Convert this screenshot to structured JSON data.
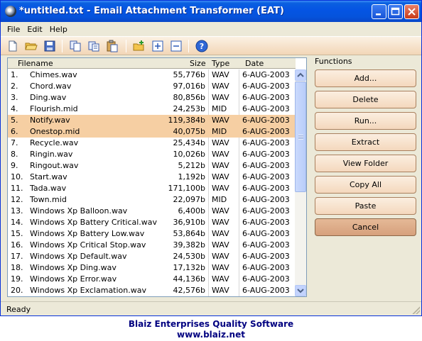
{
  "window": {
    "title": "*untitled.txt - Email Attachment Transformer (EAT)"
  },
  "menu": [
    "File",
    "Edit",
    "Help"
  ],
  "toolbar_icons": [
    "new-file-icon",
    "open-folder-icon",
    "save-icon",
    "copy-icon",
    "cut-icon",
    "paste-icon",
    "add-folder-icon",
    "add-icon",
    "remove-icon",
    "help-icon"
  ],
  "list": {
    "headers": {
      "filename": "Filename",
      "size": "Size",
      "type": "Type",
      "date": "Date"
    },
    "rows": [
      {
        "num": "1.",
        "name": "Chimes.wav",
        "size": "55,776b",
        "type": "WAV",
        "date": "6-AUG-2003",
        "selected": false
      },
      {
        "num": "2.",
        "name": "Chord.wav",
        "size": "97,016b",
        "type": "WAV",
        "date": "6-AUG-2003",
        "selected": false
      },
      {
        "num": "3.",
        "name": "Ding.wav",
        "size": "80,856b",
        "type": "WAV",
        "date": "6-AUG-2003",
        "selected": false
      },
      {
        "num": "4.",
        "name": "Flourish.mid",
        "size": "24,253b",
        "type": "MID",
        "date": "6-AUG-2003",
        "selected": false
      },
      {
        "num": "5.",
        "name": "Notify.wav",
        "size": "119,384b",
        "type": "WAV",
        "date": "6-AUG-2003",
        "selected": true
      },
      {
        "num": "6.",
        "name": "Onestop.mid",
        "size": "40,075b",
        "type": "MID",
        "date": "6-AUG-2003",
        "selected": true
      },
      {
        "num": "7.",
        "name": "Recycle.wav",
        "size": "25,434b",
        "type": "WAV",
        "date": "6-AUG-2003",
        "selected": false
      },
      {
        "num": "8.",
        "name": "Ringin.wav",
        "size": "10,026b",
        "type": "WAV",
        "date": "6-AUG-2003",
        "selected": false
      },
      {
        "num": "9.",
        "name": "Ringout.wav",
        "size": "5,212b",
        "type": "WAV",
        "date": "6-AUG-2003",
        "selected": false
      },
      {
        "num": "10.",
        "name": "Start.wav",
        "size": "1,192b",
        "type": "WAV",
        "date": "6-AUG-2003",
        "selected": false
      },
      {
        "num": "11.",
        "name": "Tada.wav",
        "size": "171,100b",
        "type": "WAV",
        "date": "6-AUG-2003",
        "selected": false
      },
      {
        "num": "12.",
        "name": "Town.mid",
        "size": "22,097b",
        "type": "MID",
        "date": "6-AUG-2003",
        "selected": false
      },
      {
        "num": "13.",
        "name": "Windows Xp Balloon.wav",
        "size": "6,400b",
        "type": "WAV",
        "date": "6-AUG-2003",
        "selected": false
      },
      {
        "num": "14.",
        "name": "Windows Xp Battery Critical.wav",
        "size": "36,910b",
        "type": "WAV",
        "date": "6-AUG-2003",
        "selected": false
      },
      {
        "num": "15.",
        "name": "Windows Xp Battery Low.wav",
        "size": "53,864b",
        "type": "WAV",
        "date": "6-AUG-2003",
        "selected": false
      },
      {
        "num": "16.",
        "name": "Windows Xp Critical Stop.wav",
        "size": "39,382b",
        "type": "WAV",
        "date": "6-AUG-2003",
        "selected": false
      },
      {
        "num": "17.",
        "name": "Windows Xp Default.wav",
        "size": "24,530b",
        "type": "WAV",
        "date": "6-AUG-2003",
        "selected": false
      },
      {
        "num": "18.",
        "name": "Windows Xp Ding.wav",
        "size": "17,132b",
        "type": "WAV",
        "date": "6-AUG-2003",
        "selected": false
      },
      {
        "num": "19.",
        "name": "Windows Xp Error.wav",
        "size": "44,136b",
        "type": "WAV",
        "date": "6-AUG-2003",
        "selected": false
      },
      {
        "num": "20.",
        "name": "Windows Xp Exclamation.wav",
        "size": "42,576b",
        "type": "WAV",
        "date": "6-AUG-2003",
        "selected": false
      }
    ]
  },
  "functions": {
    "label": "Functions",
    "buttons": [
      {
        "label": "Add...",
        "name": "add-button"
      },
      {
        "label": "Delete",
        "name": "delete-button"
      },
      {
        "label": "Run...",
        "name": "run-button"
      },
      {
        "label": "Extract",
        "name": "extract-button"
      },
      {
        "label": "View Folder",
        "name": "view-folder-button"
      },
      {
        "label": "Copy All",
        "name": "copy-all-button"
      },
      {
        "label": "Paste",
        "name": "paste-button"
      },
      {
        "label": "Cancel",
        "name": "cancel-button"
      }
    ]
  },
  "status": {
    "text": "Ready"
  },
  "footer": {
    "line1": "Blaiz Enterprises Quality Software",
    "line2": "www.blaiz.net"
  },
  "colors": {
    "selection": "#f6cfa3",
    "title_blue": "#0554e3",
    "footer_text": "#000080",
    "button_face": "#f4d8bd"
  }
}
